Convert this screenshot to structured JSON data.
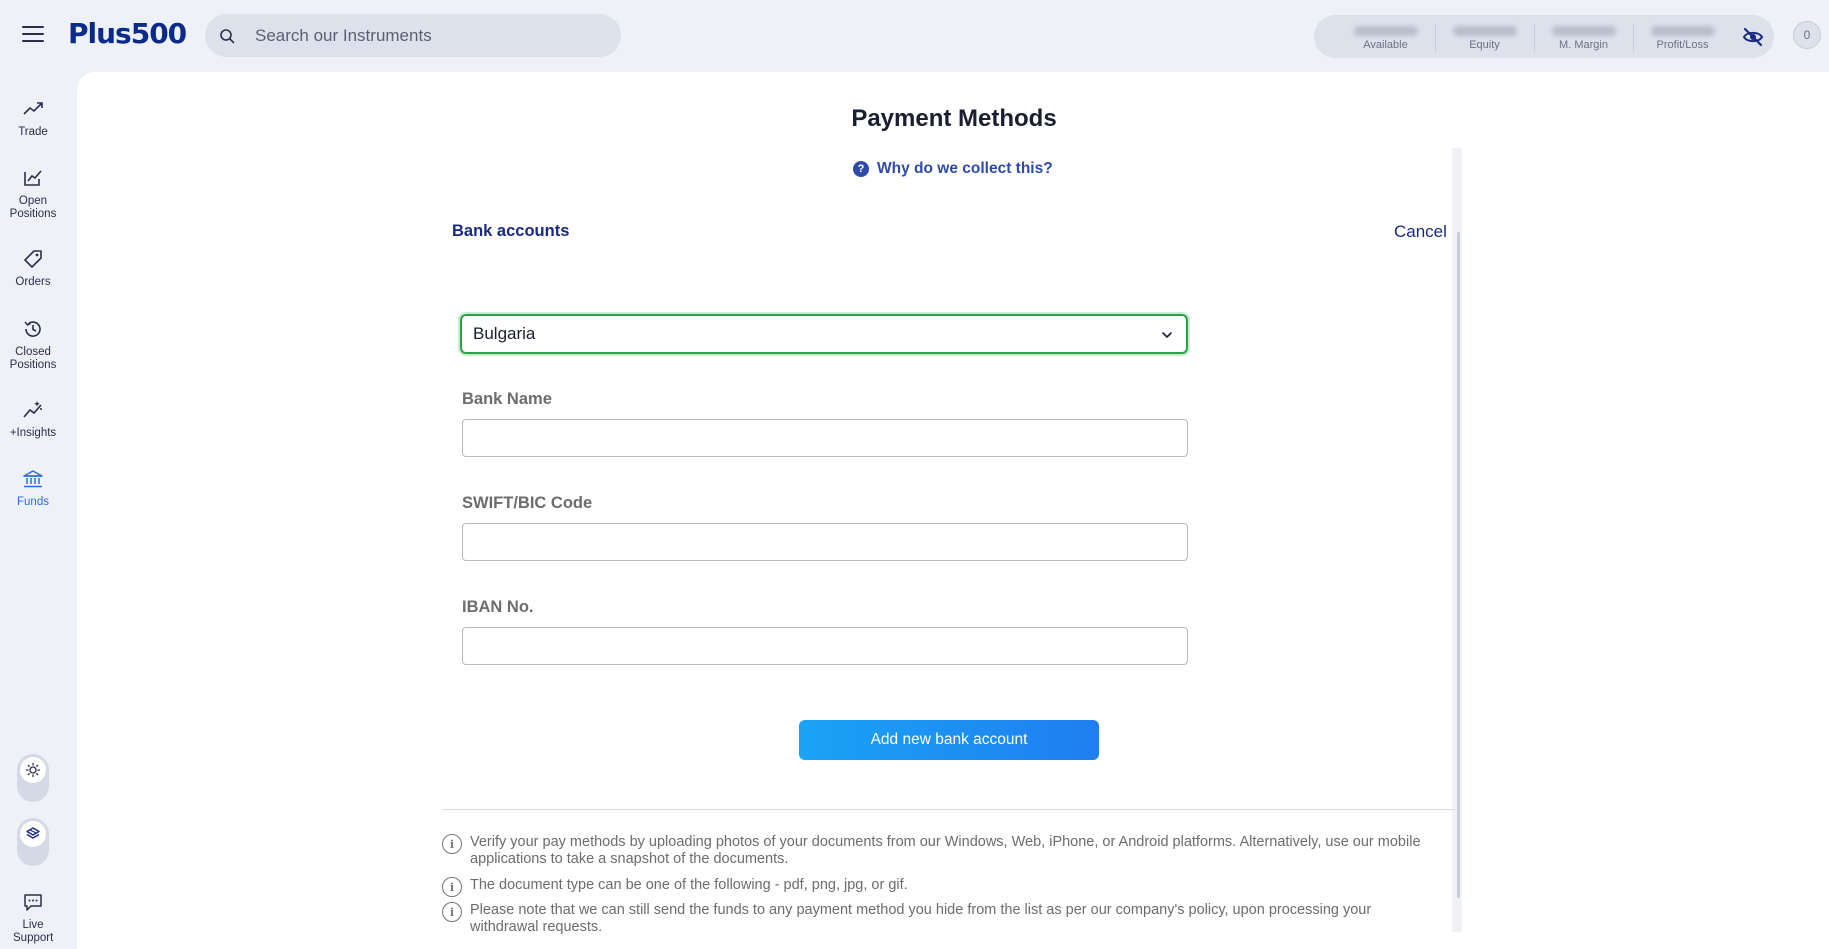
{
  "header": {
    "logo_text": "Plus500",
    "search_placeholder": "Search our Instruments",
    "stats": [
      {
        "label": "Available"
      },
      {
        "label": "Equity"
      },
      {
        "label": "M. Margin"
      },
      {
        "label": "Profit/Loss"
      }
    ],
    "notification_count": "0"
  },
  "sidebar": {
    "items": [
      {
        "label": "Trade",
        "icon": "trend-up-icon"
      },
      {
        "label": "Open Positions",
        "icon": "open-positions-icon"
      },
      {
        "label": "Orders",
        "icon": "tag-icon"
      },
      {
        "label": "Closed Positions",
        "icon": "history-icon"
      },
      {
        "label": "+Insights",
        "icon": "insights-icon"
      },
      {
        "label": "Funds",
        "icon": "bank-icon",
        "active": true
      },
      {
        "label": "Live Support",
        "icon": "chat-icon"
      }
    ],
    "accent_color": "#2a6fd6"
  },
  "main": {
    "title": "Payment Methods",
    "why_link": "Why do we collect this?",
    "section_title": "Bank accounts",
    "cancel_label": "Cancel",
    "country_select": {
      "value": "Bulgaria"
    },
    "fields": [
      {
        "label": "Bank Name",
        "value": ""
      },
      {
        "label": "SWIFT/BIC Code",
        "value": ""
      },
      {
        "label": "IBAN No.",
        "value": ""
      }
    ],
    "submit_label": "Add new bank account",
    "notes": [
      "Verify your pay methods by uploading photos of your documents from our Windows, Web, iPhone, or Android platforms. Alternatively, use our mobile applications to take a snapshot of the documents.",
      "The document type can be one of the following - pdf, png, jpg, or gif.",
      "Please note that we can still send the funds to any payment method you hide from the list as per our company's policy, upon processing your withdrawal requests."
    ]
  }
}
